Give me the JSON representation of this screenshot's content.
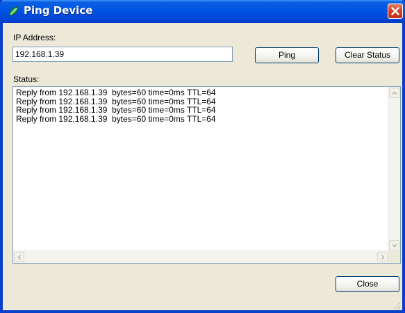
{
  "window": {
    "title": "Ping Device",
    "icon": "network-device-icon",
    "close_icon": "close-icon"
  },
  "ip_address": {
    "label": "IP Address:",
    "value": "192.168.1.39"
  },
  "buttons": {
    "ping": "Ping",
    "clear_status": "Clear Status",
    "close": "Close"
  },
  "status": {
    "label": "Status:",
    "lines": [
      "Reply from 192.168.1.39  bytes=60 time=0ms TTL=64",
      "Reply from 192.168.1.39  bytes=60 time=0ms TTL=64",
      "Reply from 192.168.1.39  bytes=60 time=0ms TTL=64",
      "Reply from 192.168.1.39  bytes=60 time=0ms TTL=64"
    ]
  },
  "colors": {
    "titlebar": "#0054e3",
    "dialog_bg": "#ece9d8",
    "close_button": "#d9452a"
  }
}
